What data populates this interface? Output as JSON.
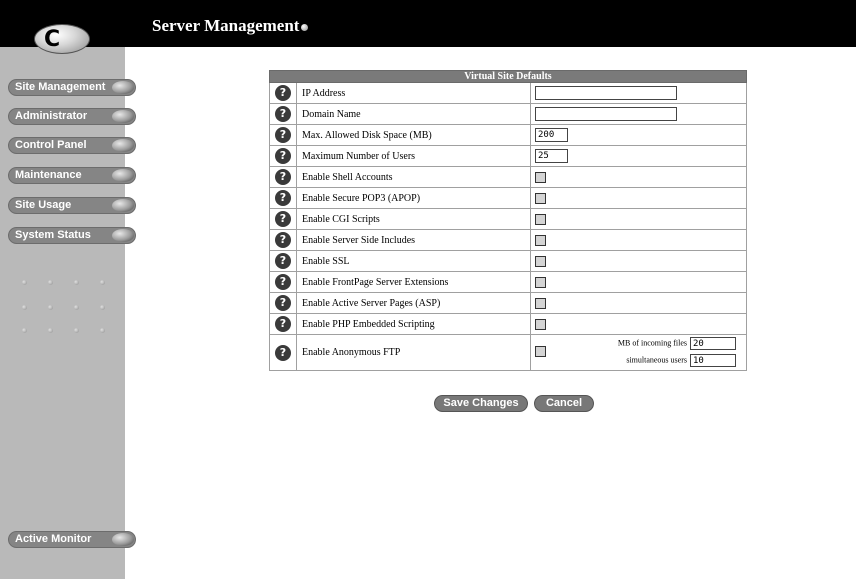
{
  "header": {
    "title": "Server Management"
  },
  "sidebar": {
    "items": [
      {
        "label": "Site Management"
      },
      {
        "label": "Administrator"
      },
      {
        "label": "Control Panel"
      },
      {
        "label": "Maintenance"
      },
      {
        "label": "Site Usage"
      },
      {
        "label": "System Status"
      }
    ],
    "bottom_item": {
      "label": "Active Monitor"
    }
  },
  "form": {
    "title": "Virtual Site Defaults",
    "rows": [
      {
        "label": "IP Address",
        "type": "text",
        "value": ""
      },
      {
        "label": "Domain Name",
        "type": "text",
        "value": ""
      },
      {
        "label": "Max. Allowed Disk Space (MB)",
        "type": "text",
        "value": "200"
      },
      {
        "label": "Maximum Number of Users",
        "type": "text",
        "value": "25"
      },
      {
        "label": "Enable Shell Accounts",
        "type": "checkbox",
        "checked": false
      },
      {
        "label": "Enable Secure POP3 (APOP)",
        "type": "checkbox",
        "checked": false
      },
      {
        "label": "Enable CGI Scripts",
        "type": "checkbox",
        "checked": false
      },
      {
        "label": "Enable Server Side Includes",
        "type": "checkbox",
        "checked": false
      },
      {
        "label": "Enable SSL",
        "type": "checkbox",
        "checked": false
      },
      {
        "label": "Enable FrontPage Server Extensions",
        "type": "checkbox",
        "checked": false
      },
      {
        "label": "Enable Active Server Pages (ASP)",
        "type": "checkbox",
        "checked": false
      },
      {
        "label": "Enable PHP Embedded Scripting",
        "type": "checkbox",
        "checked": false
      },
      {
        "label": "Enable Anonymous FTP",
        "type": "checkbox",
        "checked": false
      }
    ],
    "ftp": {
      "incoming_label": "MB of incoming files",
      "incoming_value": "20",
      "users_label": "simultaneous users",
      "users_value": "10"
    }
  },
  "actions": {
    "save": "Save Changes",
    "cancel": "Cancel"
  },
  "colors": {
    "topbar": "#000000",
    "sidebar": "#b9b9b9",
    "button": "#858585",
    "table_header": "#7a7a7a"
  },
  "icons": {
    "help": "question-mark-icon",
    "logo": "cobalt-logo-icon"
  }
}
